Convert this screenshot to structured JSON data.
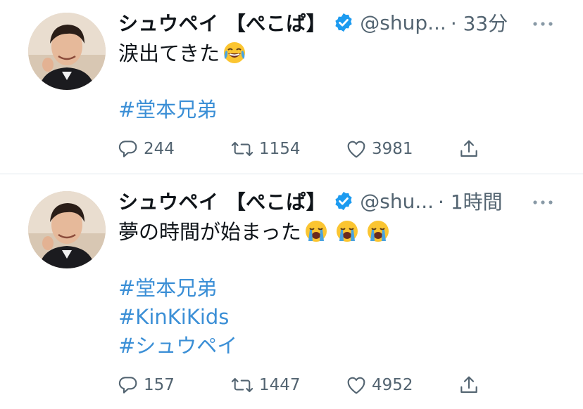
{
  "tweets": [
    {
      "display_name": "シュウペイ 【ぺこぱ】",
      "handle": "@shup...",
      "time": "· 33分",
      "text": "涙出てきた",
      "emojis": [
        "face-with-tears-of-joy"
      ],
      "hashtags": [
        "#堂本兄弟"
      ],
      "reply_count": "244",
      "retweet_count": "1154",
      "like_count": "3981"
    },
    {
      "display_name": "シュウペイ 【ぺこぱ】",
      "handle": "@shu...",
      "time": "· 1時間",
      "text": "夢の時間が始まった",
      "emojis": [
        "loudly-crying-face",
        "loudly-crying-face",
        "loudly-crying-face"
      ],
      "hashtags": [
        "#堂本兄弟",
        "#KinKiKids",
        "#シュウペイ"
      ],
      "reply_count": "157",
      "retweet_count": "1447",
      "like_count": "4952"
    }
  ],
  "icons": {
    "verified": "verified-badge-icon",
    "more": "more-options-icon",
    "reply": "reply-icon",
    "retweet": "retweet-icon",
    "like": "like-icon",
    "share": "share-icon"
  },
  "colors": {
    "verified": "#1d9bf0",
    "hashtag": "#3b8fd6",
    "secondary_text": "#536471"
  }
}
